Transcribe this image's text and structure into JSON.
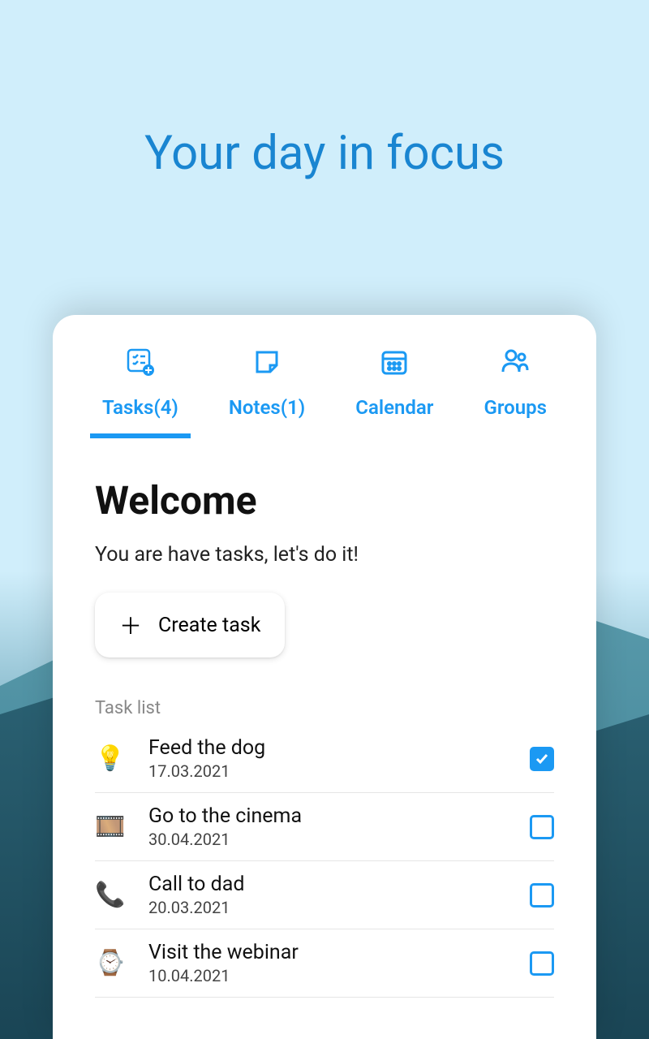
{
  "hero": {
    "title": "Your day in focus"
  },
  "tabs": [
    {
      "label": "Tasks(4)",
      "icon": "tasks"
    },
    {
      "label": "Notes(1)",
      "icon": "notes"
    },
    {
      "label": "Calendar",
      "icon": "calendar"
    },
    {
      "label": "Groups",
      "icon": "groups"
    }
  ],
  "welcome": {
    "title": "Welcome",
    "subtitle": "You are have tasks, let's do it!",
    "create_label": "Create task"
  },
  "task_list": {
    "label": "Task list",
    "items": [
      {
        "icon": "💡",
        "title": "Feed the dog",
        "date": "17.03.2021",
        "checked": true
      },
      {
        "icon": "🎞️",
        "title": "Go to the cinema",
        "date": "30.04.2021",
        "checked": false
      },
      {
        "icon": "📞",
        "title": "Call to dad",
        "date": "20.03.2021",
        "checked": false
      },
      {
        "icon": "⌚",
        "title": "Visit the webinar",
        "date": "10.04.2021",
        "checked": false
      }
    ]
  }
}
